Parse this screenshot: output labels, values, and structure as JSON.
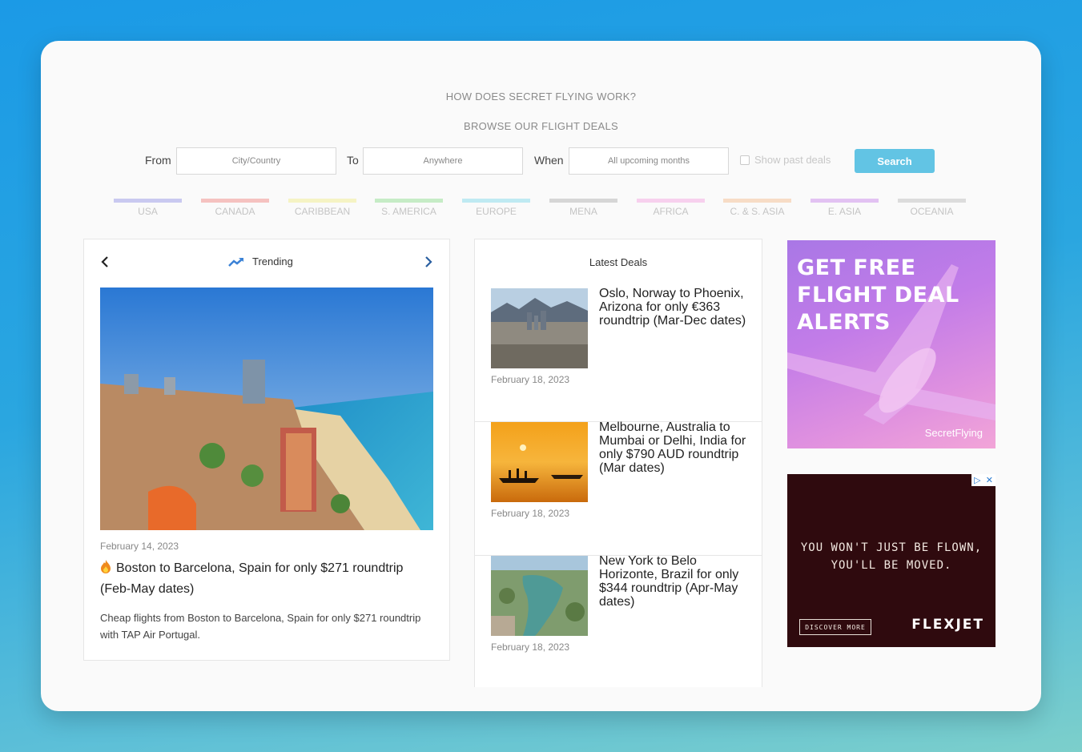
{
  "nav": {
    "how_it_works": "HOW DOES SECRET FLYING WORK?",
    "browse_deals": "BROWSE OUR FLIGHT DEALS"
  },
  "search": {
    "from_label": "From",
    "from_placeholder": "City/Country",
    "to_label": "To",
    "to_placeholder": "Anywhere",
    "when_label": "When",
    "when_placeholder": "All upcoming months",
    "past_label": "Show past deals",
    "button": "Search"
  },
  "regions": [
    {
      "label": "USA",
      "color": "#c9c9f0"
    },
    {
      "label": "CANADA",
      "color": "#f5c2c0"
    },
    {
      "label": "CARIBBEAN",
      "color": "#f5f3c4"
    },
    {
      "label": "S. AMERICA",
      "color": "#c6ecc6"
    },
    {
      "label": "EUROPE",
      "color": "#bfeaf2"
    },
    {
      "label": "MENA",
      "color": "#d6d6d6"
    },
    {
      "label": "AFRICA",
      "color": "#f7d0ee"
    },
    {
      "label": "C. & S. ASIA",
      "color": "#f7dcc6"
    },
    {
      "label": "E. ASIA",
      "color": "#e2c2f2"
    },
    {
      "label": "OCEANIA",
      "color": "#dcdcdc"
    }
  ],
  "trending": {
    "title": "Trending",
    "date": "February 14, 2023",
    "headline": "Boston to Barcelona, Spain for only $271 roundtrip (Feb-May dates)",
    "description": "Cheap flights from Boston to Barcelona, Spain for only $271 roundtrip with TAP Air Portugal."
  },
  "latest": {
    "title": "Latest Deals",
    "deals": [
      {
        "title": "Oslo, Norway to Phoenix, Arizona for only €363 roundtrip (Mar-Dec dates)",
        "date": "February 18, 2023"
      },
      {
        "title": "Melbourne, Australia to Mumbai or Delhi, India for only $790 AUD roundtrip (Mar dates)",
        "date": "February 18, 2023"
      },
      {
        "title": "New York to Belo Horizonte, Brazil for only $344 roundtrip (Apr-May dates)",
        "date": "February 18, 2023"
      }
    ]
  },
  "ads": {
    "alerts_l1": "GET FREE",
    "alerts_l2": "FLIGHT DEAL",
    "alerts_l3": "ALERTS",
    "alerts_brand": "SecretFlying",
    "flexjet_l1": "YOU WON'T JUST BE FLOWN,",
    "flexjet_l2": "YOU'LL BE MOVED.",
    "flexjet_cta": "DISCOVER MORE",
    "flexjet_brand": "FLEXJET"
  }
}
